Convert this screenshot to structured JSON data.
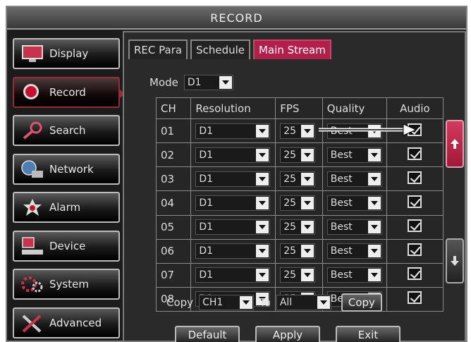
{
  "window": {
    "title": "RECORD"
  },
  "sidebar": {
    "items": [
      {
        "label": "Display",
        "icon": "monitor-icon",
        "active": false
      },
      {
        "label": "Record",
        "icon": "record-icon",
        "active": true
      },
      {
        "label": "Search",
        "icon": "magnifier-icon",
        "active": false
      },
      {
        "label": "Network",
        "icon": "network-icon",
        "active": false
      },
      {
        "label": "Alarm",
        "icon": "alarm-icon",
        "active": false
      },
      {
        "label": "Device",
        "icon": "device-icon",
        "active": false
      },
      {
        "label": "System",
        "icon": "system-icon",
        "active": false
      },
      {
        "label": "Advanced",
        "icon": "tools-icon",
        "active": false
      }
    ]
  },
  "tabs": [
    {
      "label": "REC Para",
      "active": false
    },
    {
      "label": "Schedule",
      "active": false
    },
    {
      "label": "Main Stream",
      "active": true
    }
  ],
  "mode": {
    "label": "Mode",
    "value": "D1"
  },
  "table": {
    "headers": {
      "ch": "CH",
      "resolution": "Resolution",
      "fps": "FPS",
      "quality": "Quality",
      "audio": "Audio"
    },
    "rows": [
      {
        "ch": "01",
        "resolution": "D1",
        "fps": "25",
        "quality": "Best",
        "audio": true
      },
      {
        "ch": "02",
        "resolution": "D1",
        "fps": "25",
        "quality": "Best",
        "audio": true
      },
      {
        "ch": "03",
        "resolution": "D1",
        "fps": "25",
        "quality": "Best",
        "audio": true
      },
      {
        "ch": "04",
        "resolution": "D1",
        "fps": "25",
        "quality": "Best",
        "audio": true
      },
      {
        "ch": "05",
        "resolution": "D1",
        "fps": "25",
        "quality": "Best",
        "audio": true
      },
      {
        "ch": "06",
        "resolution": "D1",
        "fps": "25",
        "quality": "Best",
        "audio": true
      },
      {
        "ch": "07",
        "resolution": "D1",
        "fps": "25",
        "quality": "Best",
        "audio": true
      },
      {
        "ch": "08",
        "resolution": "D1",
        "fps": "25",
        "quality": "Best",
        "audio": true
      }
    ]
  },
  "copy": {
    "label": "Copy",
    "from": "CH1",
    "to_label": "To",
    "to": "All",
    "button": "Copy"
  },
  "buttons": {
    "default": "Default",
    "apply": "Apply",
    "exit": "Exit"
  },
  "colors": {
    "accent": "#b0204a",
    "panel": "#2a2a2a",
    "border": "#8a8a8a"
  }
}
